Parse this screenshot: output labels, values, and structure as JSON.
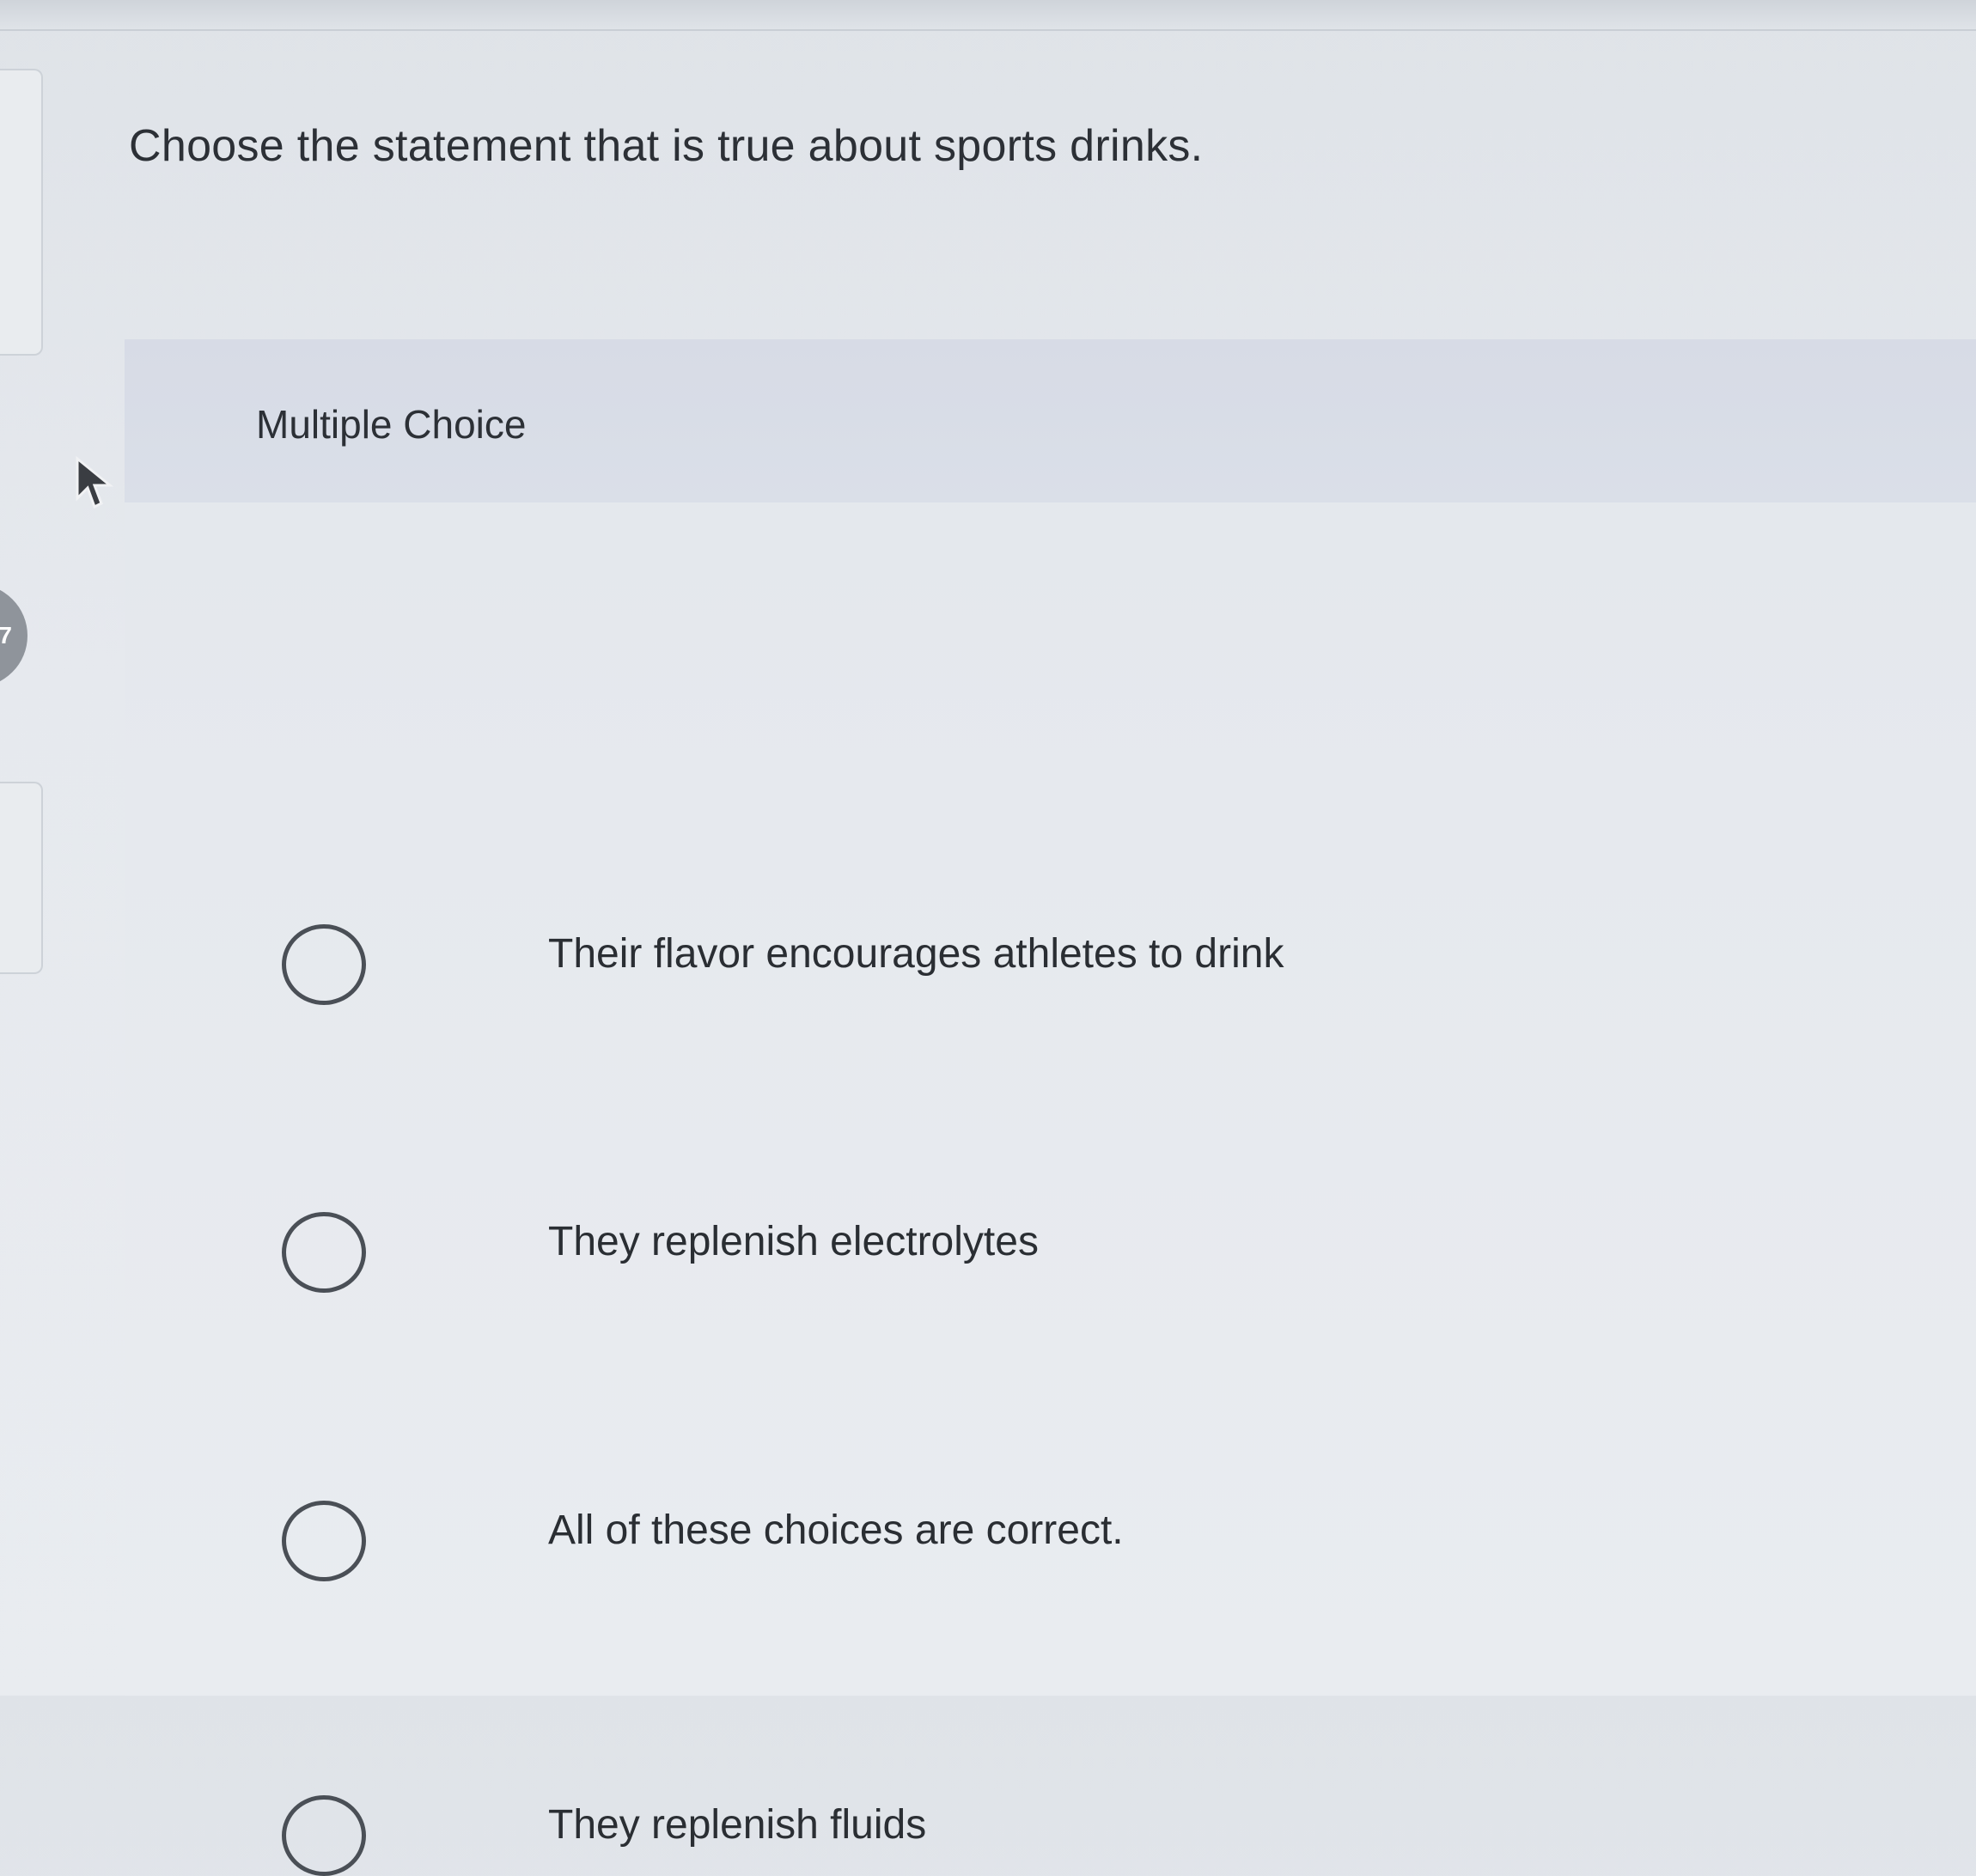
{
  "question": {
    "prompt": "Choose the statement that is true about sports drinks."
  },
  "multiple_choice": {
    "label": "Multiple Choice",
    "options": [
      {
        "text": "Their flavor encourages athletes to drink"
      },
      {
        "text": "They replenish electrolytes"
      },
      {
        "text": "All of these choices are correct."
      },
      {
        "text": "They replenish fluids"
      }
    ]
  },
  "side_badge": {
    "text": "7"
  }
}
